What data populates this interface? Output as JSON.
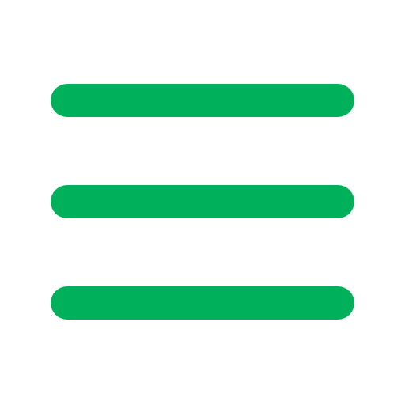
{
  "menu": {
    "icon": "hamburger-menu-icon",
    "color": "#00B05A"
  }
}
